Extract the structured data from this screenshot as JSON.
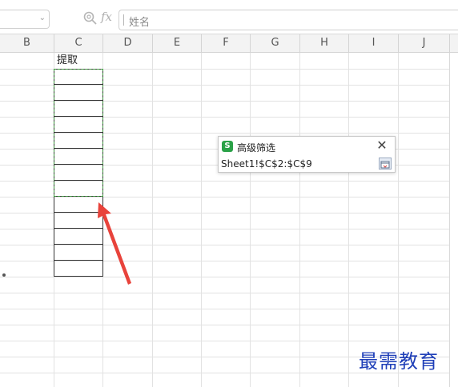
{
  "formula_bar": {
    "name_box_value": "",
    "formula_text": "姓名",
    "fx_label": "fx"
  },
  "columns": [
    "B",
    "C",
    "D",
    "E",
    "F",
    "G",
    "H",
    "I",
    "J"
  ],
  "cells": {
    "C1": "提取"
  },
  "dialog": {
    "logo": "S",
    "title": "高级筛选",
    "close_glyph": "✕",
    "range_value": "Sheet1!$C$2:$C$9",
    "accent_color": "#2aa147"
  },
  "annotation": {
    "arrow_color": "#e8433b",
    "marquee_color": "#3a9a3a"
  },
  "watermark": "最需教育"
}
